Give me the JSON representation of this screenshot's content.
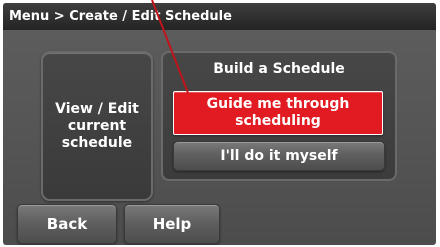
{
  "title_bar": {
    "breadcrumb": "Menu > Create / Edit Schedule"
  },
  "left": {
    "view_edit_label": "View / Edit current schedule"
  },
  "build_panel": {
    "title": "Build a Schedule",
    "guide_label": "Guide me through scheduling",
    "diy_label": "I'll do it myself"
  },
  "bottom": {
    "back_label": "Back",
    "help_label": "Help"
  },
  "colors": {
    "accent": "#e21b22",
    "screen_bg": "#555555",
    "title_bar": "#2a2a2a",
    "callout_line": "#c0141b"
  }
}
